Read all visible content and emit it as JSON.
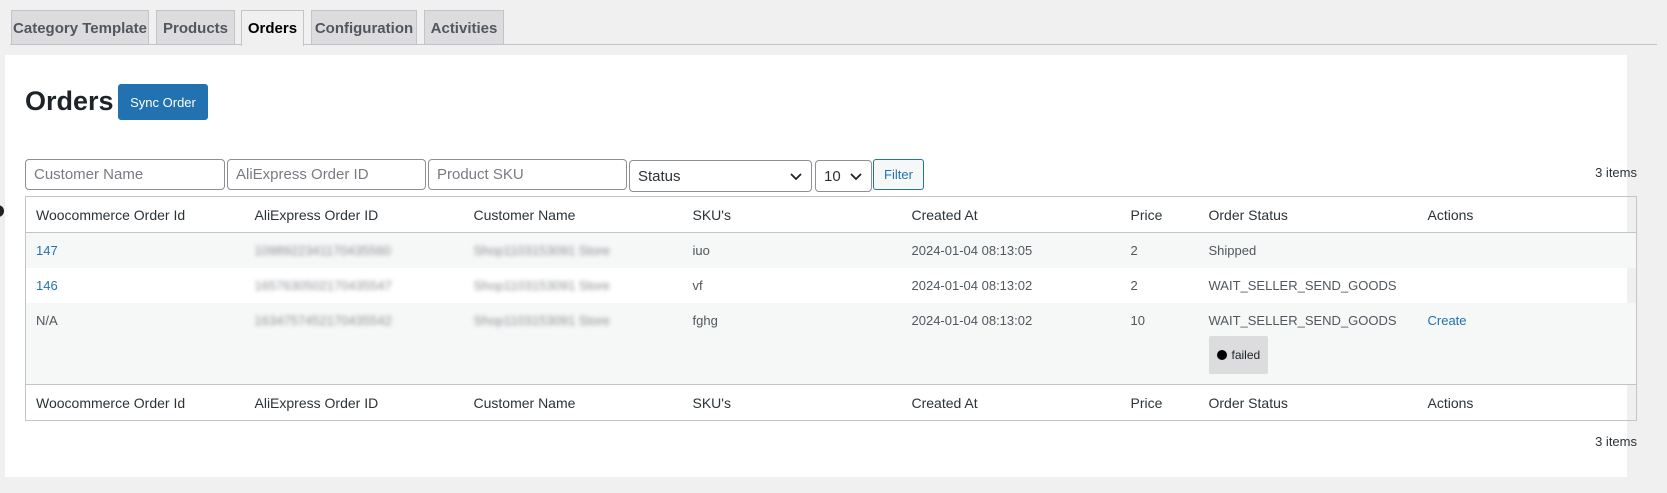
{
  "tabs": [
    {
      "label": "Category Template",
      "active": false
    },
    {
      "label": "Products",
      "active": false
    },
    {
      "label": "Orders",
      "active": true
    },
    {
      "label": "Configuration",
      "active": false
    },
    {
      "label": "Activities",
      "active": false
    }
  ],
  "page": {
    "title": "Orders",
    "sync_button": "Sync Order"
  },
  "filters": {
    "customer_name_placeholder": "Customer Name",
    "aliexpress_order_placeholder": "AliExpress Order ID",
    "product_sku_placeholder": "Product SKU",
    "status_selected": "Status",
    "per_page_selected": "10",
    "filter_button": "Filter"
  },
  "items_count": "3 items",
  "table": {
    "columns": [
      "Woocommerce Order Id",
      "AliExpress Order ID",
      "Customer Name",
      "SKU's",
      "Created At",
      "Price",
      "Order Status",
      "Actions"
    ],
    "rows": [
      {
        "wc_order_id": "147",
        "aliexpress_order_id": "1098922341170435560",
        "customer_name": "Shop1103153091 Store",
        "sku": "iuo",
        "created_at": "2024-01-04 08:13:05",
        "price": "2",
        "order_status": "Shipped",
        "action": "",
        "badge": ""
      },
      {
        "wc_order_id": "146",
        "aliexpress_order_id": "1657630502170435547",
        "customer_name": "Shop1103153091 Store",
        "sku": "vf",
        "created_at": "2024-01-04 08:13:02",
        "price": "2",
        "order_status": "WAIT_SELLER_SEND_GOODS",
        "action": "",
        "badge": ""
      },
      {
        "wc_order_id": "N/A",
        "aliexpress_order_id": "1634757452170435542",
        "customer_name": "Shop1103153091 Store",
        "sku": "fghg",
        "created_at": "2024-01-04 08:13:02",
        "price": "10",
        "order_status": "WAIT_SELLER_SEND_GOODS",
        "action": "Create",
        "badge": "failed"
      }
    ]
  },
  "colors": {
    "primary": "#2271b1",
    "background": "#f0f0f1",
    "panel": "#ffffff"
  }
}
